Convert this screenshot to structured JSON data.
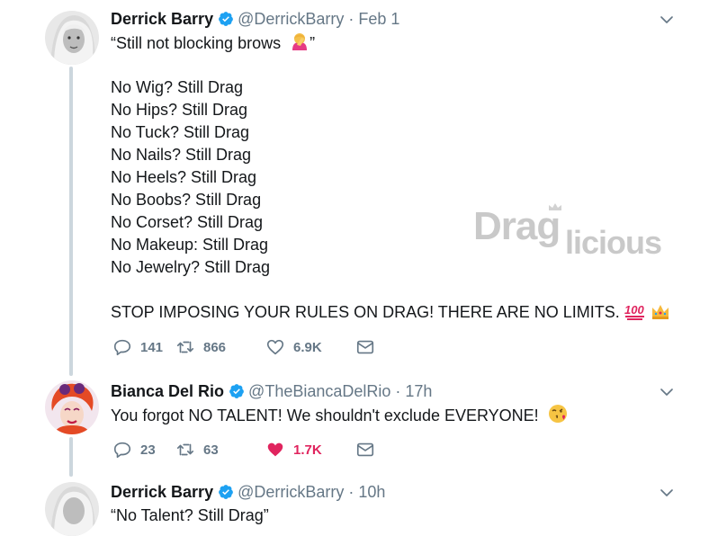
{
  "colors": {
    "text": "#14171a",
    "muted": "#657786",
    "verified": "#1da1f2",
    "heart": "#e0245e",
    "thread_line": "#ccd6dd"
  },
  "tweets": [
    {
      "name": "Derrick Barry",
      "handle": "@DerrickBarry",
      "separator": "·",
      "time": "Feb 1",
      "lines": [
        "“Still not blocking brows",
        "",
        "No Wig? Still Drag",
        "No Hips? Still Drag",
        "No Tuck? Still Drag",
        "No Nails? Still Drag",
        "No Heels? Still Drag",
        "No Boobs? Still Drag",
        "No Corset? Still Drag",
        "No Makeup: Still Drag",
        "No Jewelry? Still Drag",
        "",
        "STOP IMPOSING YOUR RULES ON DRAG! THERE ARE NO LIMITS."
      ],
      "first_line_suffix": "”",
      "emoji": [
        "facepalm-woman-emoji",
        "hundred-points-emoji",
        "crown-emoji"
      ],
      "replies": "141",
      "retweets": "866",
      "likes": "6.9K"
    },
    {
      "name": "Bianca Del Rio",
      "handle": "@TheBiancaDelRio",
      "separator": "·",
      "time": "17h",
      "text": "You forgot NO TALENT! We shouldn't exclude EVERYONE!",
      "emoji": [
        "face-blowing-kiss-emoji"
      ],
      "replies": "23",
      "retweets": "63",
      "likes": "1.7K",
      "liked": true
    },
    {
      "name": "Derrick Barry",
      "handle": "@DerrickBarry",
      "separator": "·",
      "time": "10h",
      "text": "“No Talent? Still Drag”"
    }
  ],
  "watermark": {
    "brand": "Dragilicious"
  }
}
